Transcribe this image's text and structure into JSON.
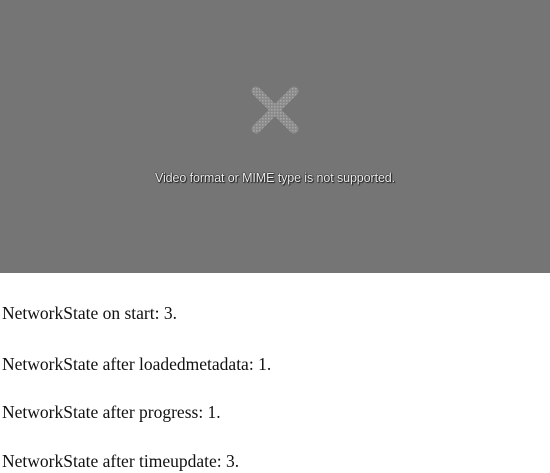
{
  "video": {
    "error_icon": "x-icon",
    "error_message": "Video format or MIME type is not supported.",
    "background_color": "#757575"
  },
  "log_lines": [
    "NetworkState on start: 3.",
    "NetworkState after loadedmetadata: 1.",
    "NetworkState after progress: 1.",
    "NetworkState after timeupdate: 3."
  ]
}
